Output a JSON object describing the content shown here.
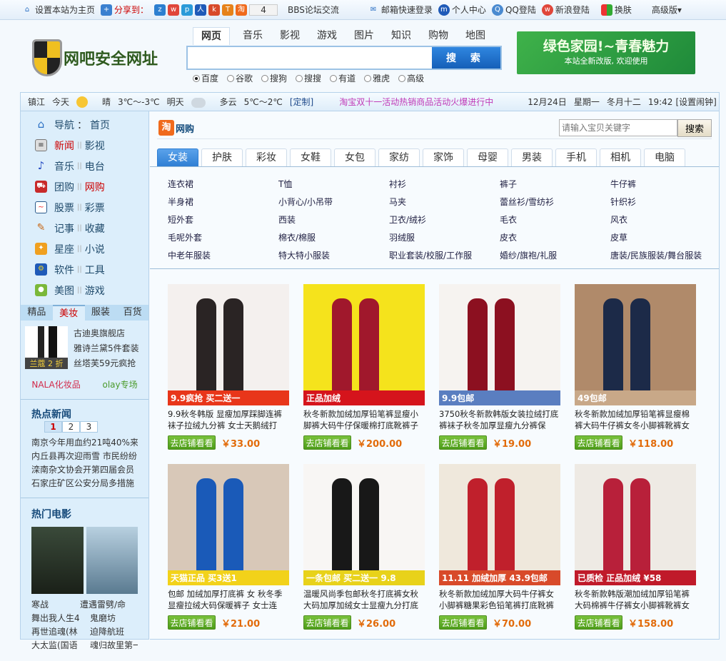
{
  "topbar": {
    "set_home": "设置本站为主页",
    "share_to": "分享到：",
    "share_count": "4",
    "bbs": "BBS论坛交流",
    "mail_login": "邮箱快速登录",
    "user_center": "个人中心",
    "qq_login": "QQ登陆",
    "sina_login": "新浪登陆",
    "skin": "换肤",
    "advanced": "高级版▾"
  },
  "header": {
    "logo_text": "网吧安全网址",
    "search_tabs": [
      "网页",
      "音乐",
      "影视",
      "游戏",
      "图片",
      "知识",
      "购物",
      "地图"
    ],
    "search_button": "搜 索",
    "search_value": "",
    "engines": [
      "百度",
      "谷歌",
      "搜狗",
      "搜搜",
      "有道",
      "雅虎",
      "高级"
    ],
    "banner_title": "绿色家园!~青春魅力",
    "banner_sub": "本站全新改版, 欢迎使用"
  },
  "infobar": {
    "city": "镇江",
    "today": "今天",
    "today_weather": "晴",
    "today_temp": "3℃～-3℃",
    "tomorrow": "明天",
    "tomorrow_weather": "多云",
    "tomorrow_temp": "5℃～2℃",
    "customize": "[定制]",
    "promo": "淘宝双十一活动热销商品活动火爆进行中",
    "date": "12月24日",
    "weekday": "星期一",
    "lunar": "冬月十二",
    "time": "19:42",
    "alarm": "[设置闹钟]"
  },
  "sidebar": {
    "nav": [
      [
        "导航",
        "首页"
      ],
      [
        "新闻",
        "影视"
      ],
      [
        "音乐",
        "电台"
      ],
      [
        "团购",
        "网购"
      ],
      [
        "股票",
        "彩票"
      ],
      [
        "记事",
        "收藏"
      ],
      [
        "星座",
        "小说"
      ],
      [
        "软件",
        "工具"
      ],
      [
        "美图",
        "游戏"
      ]
    ],
    "shop_tabs": [
      "精品",
      "美妆",
      "服装",
      "百货"
    ],
    "promo_img_label": "兰蔻 2 折",
    "promo_items": [
      "古迪奥旗舰店",
      "雅诗兰黛5件套装",
      "丝塔芙59元疯抢"
    ],
    "promo_links": [
      "NALA化妆品",
      "olay专场"
    ],
    "hot_news_title": "热点新闻",
    "hot_pages": [
      "1",
      "2",
      "3"
    ],
    "hot_news": [
      "南京今年用血约21吨40%来",
      "内丘县再次迎雨雪 市民纷纷",
      "滦南杂文协会开第四届会员",
      "石家庄矿区公安分局多措施"
    ],
    "movies_title": "热门电影",
    "movies": [
      [
        "寒战",
        "遭遇雷劈/命"
      ],
      [
        "舞出我人生4",
        "鬼磨坊"
      ],
      [
        "再世追魂(林",
        "迫降航班"
      ],
      [
        "大太监(国语",
        "魂归故里第一"
      ]
    ]
  },
  "main": {
    "title": "网购",
    "search_placeholder": "请输入宝贝关键字",
    "search_button": "搜索",
    "tabs": [
      "女装",
      "护肤",
      "彩妆",
      "女鞋",
      "女包",
      "家纺",
      "家饰",
      "母婴",
      "男装",
      "手机",
      "相机",
      "电脑"
    ],
    "subcats": [
      "连衣裙",
      "T恤",
      "衬衫",
      "裤子",
      "牛仔裤",
      "半身裙",
      "小背心/小吊带",
      "马夹",
      "蕾丝衫/雪纺衫",
      "针织衫",
      "短外套",
      "西装",
      "卫衣/绒衫",
      "毛衣",
      "风衣",
      "毛呢外套",
      "棉衣/棉服",
      "羽绒服",
      "皮衣",
      "皮草",
      "中老年服装",
      "特大特小服装",
      "职业套装/校服/工作服",
      "婚纱/旗袍/礼服",
      "唐装/民族服装/舞台服装"
    ],
    "shop_button": "去店铺看看",
    "products": [
      {
        "title": "9.9秋冬韩版 显瘦加厚踩脚连裤袜子拉绒九分裤 女士天鹅绒打",
        "price": "￥33.00",
        "tag": "9.9疯抢 买二送一",
        "bg": "#f4f0ee",
        "leg": "#2a2424",
        "band": "#e8361a"
      },
      {
        "title": "秋冬新款加绒加厚铅笔裤显瘦小脚裤大码牛仔保暖棉打底靴裤子",
        "price": "￥200.00",
        "tag": "正品加绒",
        "bg": "#f5e31c",
        "leg": "#a0182c",
        "band": "#d5141c"
      },
      {
        "title": "3750秋冬新款韩版女装拉绒打底裤袜子秋冬加厚显瘦九分裤保",
        "price": "￥19.00",
        "tag": "9.9包邮",
        "bg": "#f6f3f0",
        "leg": "#8c1020",
        "band": "#5a7ec0"
      },
      {
        "title": "秋冬新款加绒加厚铅笔裤显瘦棉裤大码牛仔裤女冬小脚裤靴裤女",
        "price": "￥118.00",
        "tag": "49包邮",
        "bg": "#b08a6a",
        "leg": "#1c2a48",
        "band": "#c8a888"
      },
      {
        "title": "包邮 加绒加厚打底裤 女 秋冬季显瘦拉绒大码保暖裤子 女士连",
        "price": "￥21.00",
        "tag": "天猫正品 买3送1",
        "bg": "#d8c8b8",
        "leg": "#1a5ab8",
        "band": "#f2d21a"
      },
      {
        "title": "温暖风尚季包邮秋冬打底裤女秋大码加厚加绒女士显瘦九分打底",
        "price": "￥26.00",
        "tag": "一条包邮 买二送一 9.8",
        "bg": "#f8f6f4",
        "leg": "#181818",
        "band": "#e8d21a"
      },
      {
        "title": "秋冬新款加绒加厚大码牛仔裤女小脚裤糖果彩色铅笔裤打底靴裤",
        "price": "￥70.00",
        "tag": "11.11 加绒加厚 43.9包邮",
        "bg": "#efe8dc",
        "leg": "#c0202c",
        "band": "#d84a2a"
      },
      {
        "title": "秋冬新款韩版潮加绒加厚铅笔裤大码棉裤牛仔裤女小脚裤靴裤女",
        "price": "￥158.00",
        "tag": "已质检 正品加绒 ¥58",
        "bg": "#eeeae4",
        "leg": "#b8203a",
        "band": "#c01a2a"
      }
    ]
  }
}
